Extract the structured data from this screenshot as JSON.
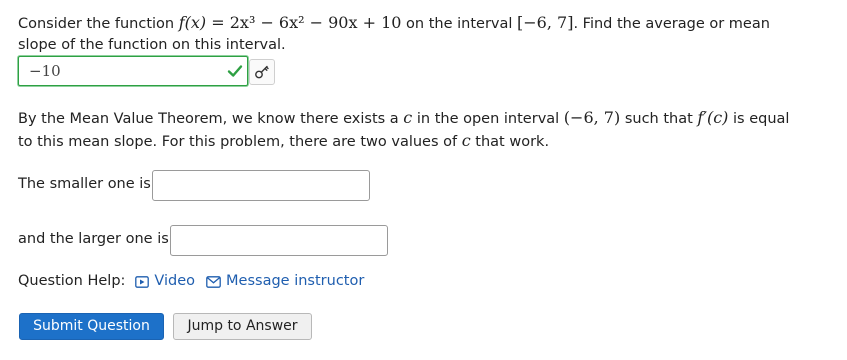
{
  "question": {
    "intro": "Consider the function ",
    "function_lhs": "f(x) = ",
    "function_rhs": "2x³ − 6x² − 90x + 10",
    "interval_text": " on the interval ",
    "interval": "[−6, 7]",
    "ask": ". Find the average or mean",
    "ask_line2": "slope of the function on this interval."
  },
  "mean_slope_answer": {
    "value": "−10",
    "status": "correct"
  },
  "mvt": {
    "line1_a": "By the Mean Value Theorem, we know there exists a ",
    "var_c": "c",
    "line1_b": " in the open interval ",
    "open_interval": "(−6, 7)",
    "line1_c": " such that ",
    "derivative": "f′(c)",
    "line1_d": " is equal",
    "line2_a": "to this mean slope. For this problem, there are two values of ",
    "line2_c": "c",
    "line2_b": " that work."
  },
  "smaller": {
    "label": "The smaller one is",
    "value": ""
  },
  "larger": {
    "label": "and the larger one is",
    "value": ""
  },
  "help": {
    "label": "Question Help:",
    "video": "Video",
    "message": "Message instructor"
  },
  "buttons": {
    "submit": "Submit Question",
    "jump": "Jump to Answer"
  },
  "colors": {
    "link": "#1f5eaf",
    "correct_border": "#2ea043",
    "primary_button": "#1d71c9"
  },
  "icons": {
    "check": "check-icon",
    "key": "key-icon",
    "video": "video-icon",
    "message": "envelope-icon"
  }
}
